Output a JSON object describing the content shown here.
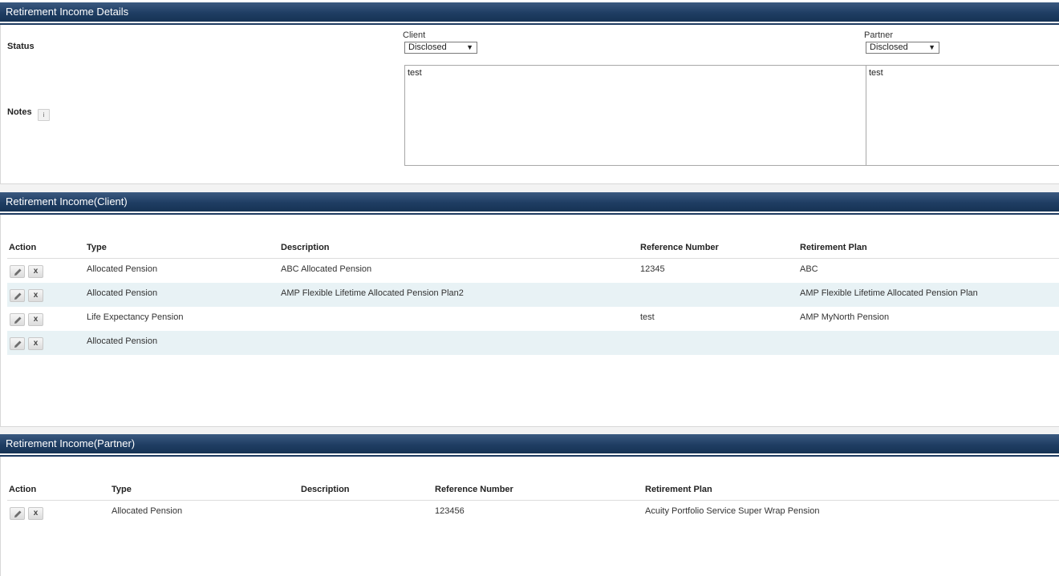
{
  "details": {
    "title": "Retirement Income Details",
    "status_label": "Status",
    "notes_label": "Notes",
    "info_icon": "i",
    "client_label": "Client",
    "partner_label": "Partner",
    "client_status": "Disclosed",
    "partner_status": "Disclosed",
    "client_notes": "test",
    "partner_notes": "test"
  },
  "client_section": {
    "title": "Retirement Income(Client)",
    "columns": [
      "Action",
      "Type",
      "Description",
      "Reference Number",
      "Retirement Plan"
    ],
    "rows": [
      {
        "type": "Allocated Pension",
        "description": "ABC Allocated Pension",
        "reference": "12345",
        "plan": "ABC"
      },
      {
        "type": "Allocated Pension",
        "description": "AMP Flexible Lifetime Allocated Pension Plan2",
        "reference": "",
        "plan": "AMP Flexible Lifetime Allocated Pension Plan"
      },
      {
        "type": "Life Expectancy Pension",
        "description": "",
        "reference": "test",
        "plan": "AMP MyNorth Pension"
      },
      {
        "type": "Allocated Pension",
        "description": "",
        "reference": "",
        "plan": ""
      }
    ]
  },
  "partner_section": {
    "title": "Retirement Income(Partner)",
    "columns": [
      "Action",
      "Type",
      "Description",
      "Reference Number",
      "Retirement Plan"
    ],
    "rows": [
      {
        "type": "Allocated Pension",
        "description": "",
        "reference": "123456",
        "plan": "Acuity Portfolio Service Super Wrap Pension"
      }
    ]
  },
  "icons": {
    "edit": "pencil-icon",
    "delete_label": "x"
  },
  "colors": {
    "header_dark": "#1f3d63",
    "row_alt": "#e8f2f5"
  }
}
